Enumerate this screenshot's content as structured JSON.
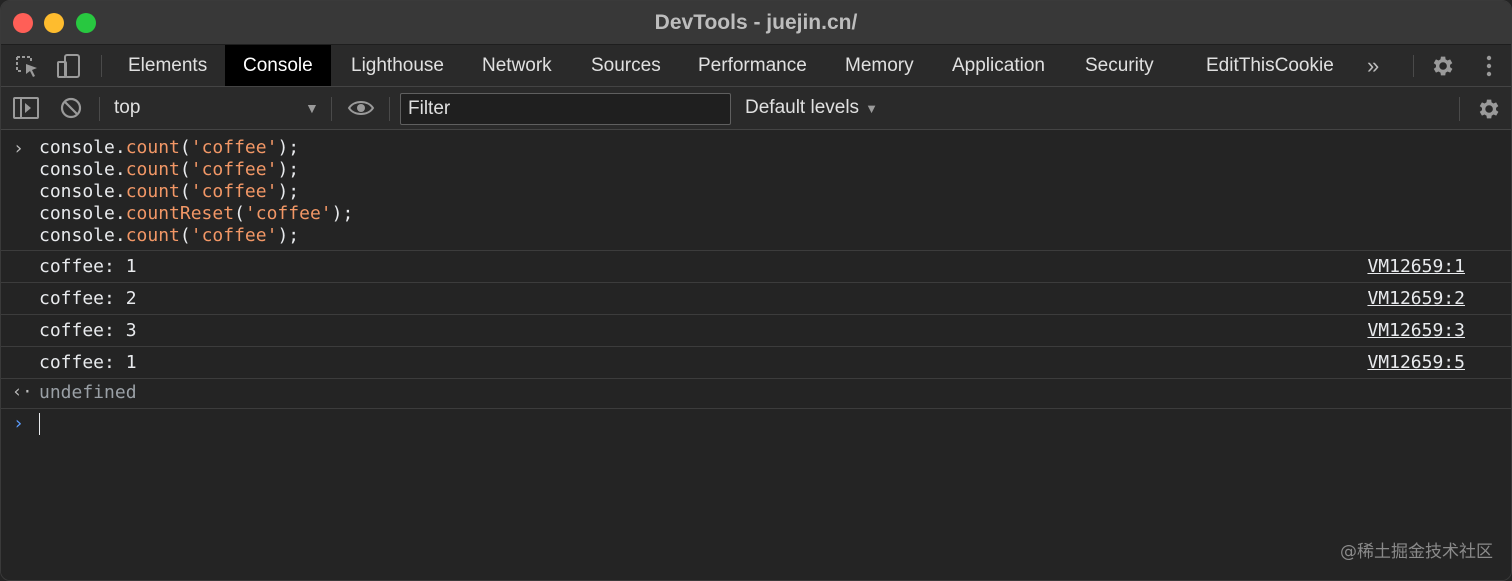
{
  "window": {
    "title": "DevTools - juejin.cn/"
  },
  "tabs": [
    {
      "label": "Elements"
    },
    {
      "label": "Console"
    },
    {
      "label": "Lighthouse"
    },
    {
      "label": "Network"
    },
    {
      "label": "Sources"
    },
    {
      "label": "Performance"
    },
    {
      "label": "Memory"
    },
    {
      "label": "Application"
    },
    {
      "label": "Security"
    },
    {
      "label": "EditThisCookie"
    }
  ],
  "active_tab": "Console",
  "tabbar": {
    "more_label": "»"
  },
  "toolbar": {
    "context": "top",
    "filter_placeholder": "Filter",
    "levels_label": "Default levels"
  },
  "console": {
    "input": {
      "lines": [
        {
          "obj": "console.",
          "method": "count",
          "open": "(",
          "arg": "'coffee'",
          "close": ");"
        },
        {
          "obj": "console.",
          "method": "count",
          "open": "(",
          "arg": "'coffee'",
          "close": ");"
        },
        {
          "obj": "console.",
          "method": "count",
          "open": "(",
          "arg": "'coffee'",
          "close": ");"
        },
        {
          "obj": "console.",
          "method": "countReset",
          "open": "(",
          "arg": "'coffee'",
          "close": ");"
        },
        {
          "obj": "console.",
          "method": "count",
          "open": "(",
          "arg": "'coffee'",
          "close": ");"
        }
      ]
    },
    "logs": [
      {
        "text": "coffee: 1",
        "source": "VM12659:1"
      },
      {
        "text": "coffee: 2",
        "source": "VM12659:2"
      },
      {
        "text": "coffee: 3",
        "source": "VM12659:3"
      },
      {
        "text": "coffee: 1",
        "source": "VM12659:5"
      }
    ],
    "result": "undefined"
  },
  "watermark": "@稀土掘金技术社区",
  "colors": {
    "accent_prompt": "#5c9dff",
    "string": "#f29766",
    "active_tab_bg": "#000000"
  }
}
